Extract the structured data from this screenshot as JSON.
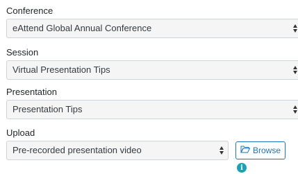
{
  "form": {
    "conference": {
      "label": "Conference",
      "value": "eAttend Global Annual Conference"
    },
    "session": {
      "label": "Session",
      "value": "Virtual Presentation Tips"
    },
    "presentation": {
      "label": "Presentation",
      "value": "Presentation Tips"
    },
    "upload": {
      "label": "Upload",
      "value": "Pre-recorded presentation video",
      "browse_label": "Browse",
      "browse_icon": "folder-open-icon",
      "info_icon": "info-icon"
    }
  },
  "colors": {
    "accent": "#1f73b7",
    "info": "#17a2b8",
    "field_bg": "#f5f5f5",
    "field_border": "#ced4da"
  }
}
